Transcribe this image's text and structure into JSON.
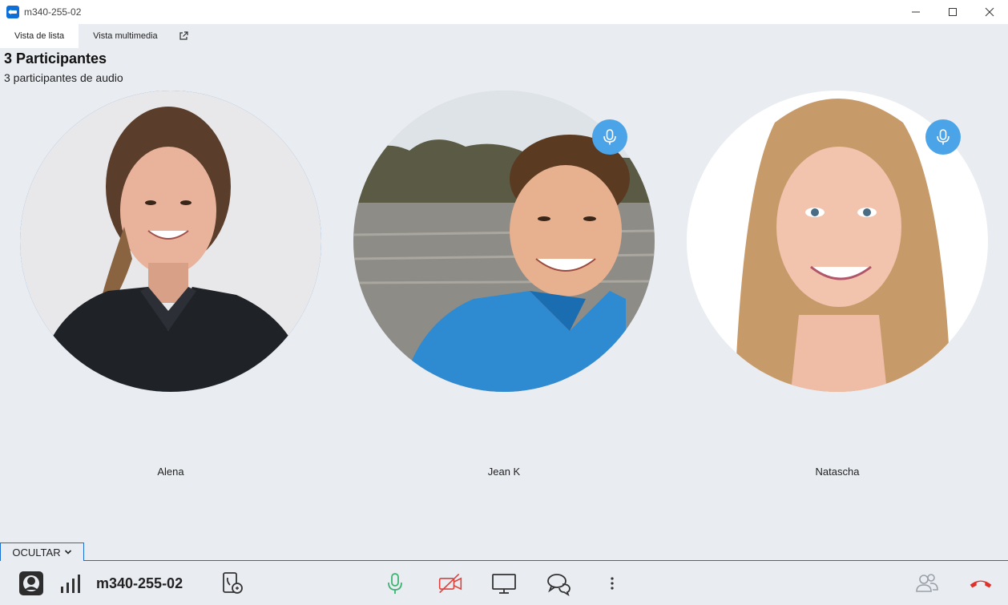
{
  "window": {
    "title": "m340-255-02",
    "controls": [
      "minimize-icon",
      "maximize-icon",
      "close-icon"
    ]
  },
  "tabs": [
    {
      "label": "Vista de lista",
      "active": true
    },
    {
      "label": "Vista multimedia",
      "active": false
    }
  ],
  "header": {
    "title": "3 Participantes",
    "subtitle": "3 participantes de audio"
  },
  "participants": [
    {
      "name": "Alena",
      "speaking": true,
      "mic_icon": false
    },
    {
      "name": "Jean K",
      "speaking": false,
      "mic_icon": true
    },
    {
      "name": "Natascha",
      "speaking": false,
      "mic_icon": true
    }
  ],
  "bottombar": {
    "hide_label": "OCULTAR",
    "meeting_id": "m340-255-02",
    "icons": [
      "avatar-icon",
      "signal-icon",
      "phone-dialin-icon",
      "microphone-icon",
      "camera-off-icon",
      "screen-share-icon",
      "chat-icon",
      "more-icon",
      "participants-icon",
      "hang-up-icon"
    ]
  },
  "colors": {
    "accent": "#1a6fd1",
    "mic_badge": "#4ba3e8",
    "mic_on": "#3cb371",
    "camera_off": "#e0413c",
    "hang_up": "#e0302b"
  }
}
